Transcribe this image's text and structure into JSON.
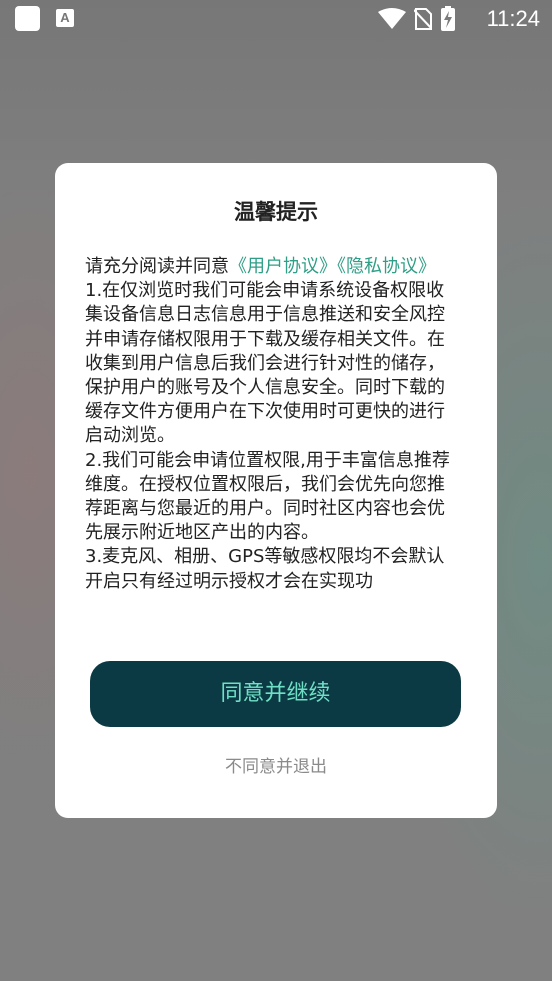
{
  "status_bar": {
    "time": "11:24",
    "icons": [
      "notification-square-icon",
      "app-a-icon",
      "wifi-icon",
      "no-sim-icon",
      "battery-charging-icon"
    ]
  },
  "dialog": {
    "title": "温馨提示",
    "intro_text": "请充分阅读并同意",
    "link_user_agreement": "《用户协议》",
    "link_privacy": "《隐私协议》",
    "paragraphs": [
      "1.在仅浏览时我们可能会申请系统设备权限收集设备信息日志信息用于信息推送和安全风控并申请存储权限用于下载及缓存相关文件。在收集到用户信息后我们会进行针对性的储存，保护用户的账号及个人信息安全。同时下载的缓存文件方便用户在下次使用时可更快的进行启动浏览。",
      "2.我们可能会申请位置权限,用于丰富信息推荐维度。在授权位置权限后，我们会优先向您推荐距离与您最近的用户。同时社区内容也会优先展示附近地区产出的内容。",
      "3.麦克风、相册、GPS等敏感权限均不会默认开启只有经过明示授权才会在实现功"
    ],
    "agree_button": "同意并继续",
    "decline_button": "不同意并退出"
  },
  "colors": {
    "link": "#2f9e86",
    "button_bg": "#0b3a44",
    "button_text": "#6fe0c6",
    "overlay": "#7f7f7f"
  }
}
